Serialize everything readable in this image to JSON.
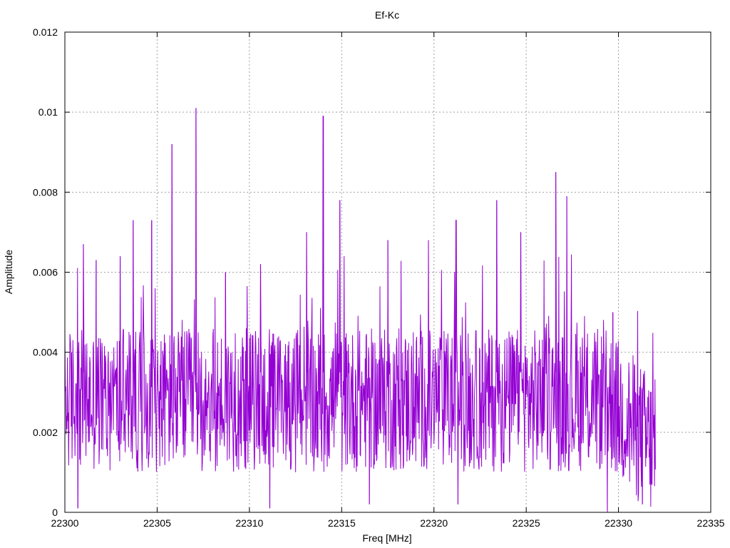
{
  "chart_data": {
    "type": "line",
    "title": "Ef-Kc",
    "xlabel": "Freq [MHz]",
    "ylabel": "Amplitude",
    "xlim": [
      22300,
      22335
    ],
    "ylim": [
      0,
      0.012
    ],
    "x_ticks": [
      "22300",
      "22305",
      "22310",
      "22315",
      "22320",
      "22325",
      "22330",
      "22335"
    ],
    "y_ticks": [
      "0",
      "0.002",
      "0.004",
      "0.006",
      "0.008",
      "0.01",
      "0.012"
    ],
    "x_tick_values": [
      22300,
      22305,
      22310,
      22315,
      22320,
      22325,
      22330,
      22335
    ],
    "y_tick_values": [
      0,
      0.002,
      0.004,
      0.006,
      0.008,
      0.01,
      0.012
    ],
    "grid": true,
    "line_color": "#9400d3",
    "series": [
      {
        "x_start": 22300,
        "x_end": 22332,
        "peaks": [
          {
            "x": 22301.0,
            "y": 0.0067
          },
          {
            "x": 22301.7,
            "y": 0.0063
          },
          {
            "x": 22303.0,
            "y": 0.0064
          },
          {
            "x": 22303.7,
            "y": 0.0073
          },
          {
            "x": 22304.7,
            "y": 0.0073
          },
          {
            "x": 22305.8,
            "y": 0.0092
          },
          {
            "x": 22307.1,
            "y": 0.0101
          },
          {
            "x": 22308.7,
            "y": 0.006
          },
          {
            "x": 22310.6,
            "y": 0.0062
          },
          {
            "x": 22313.1,
            "y": 0.007
          },
          {
            "x": 22314.0,
            "y": 0.0099
          },
          {
            "x": 22314.9,
            "y": 0.0078
          },
          {
            "x": 22317.5,
            "y": 0.0068
          },
          {
            "x": 22319.7,
            "y": 0.0068
          },
          {
            "x": 22321.2,
            "y": 0.0073
          },
          {
            "x": 22323.4,
            "y": 0.0078
          },
          {
            "x": 22324.7,
            "y": 0.007
          },
          {
            "x": 22326.6,
            "y": 0.0085
          },
          {
            "x": 22327.2,
            "y": 0.0079
          },
          {
            "x": 22329.7,
            "y": 0.005
          }
        ],
        "dips": [
          {
            "x": 22300.7,
            "y": 0.0001
          },
          {
            "x": 22311.1,
            "y": 0.0001
          },
          {
            "x": 22316.5,
            "y": 0.0002
          },
          {
            "x": 22321.3,
            "y": 0.0002
          },
          {
            "x": 22329.4,
            "y": 0.0
          },
          {
            "x": 22331.3,
            "y": 0.0002
          }
        ]
      }
    ]
  }
}
